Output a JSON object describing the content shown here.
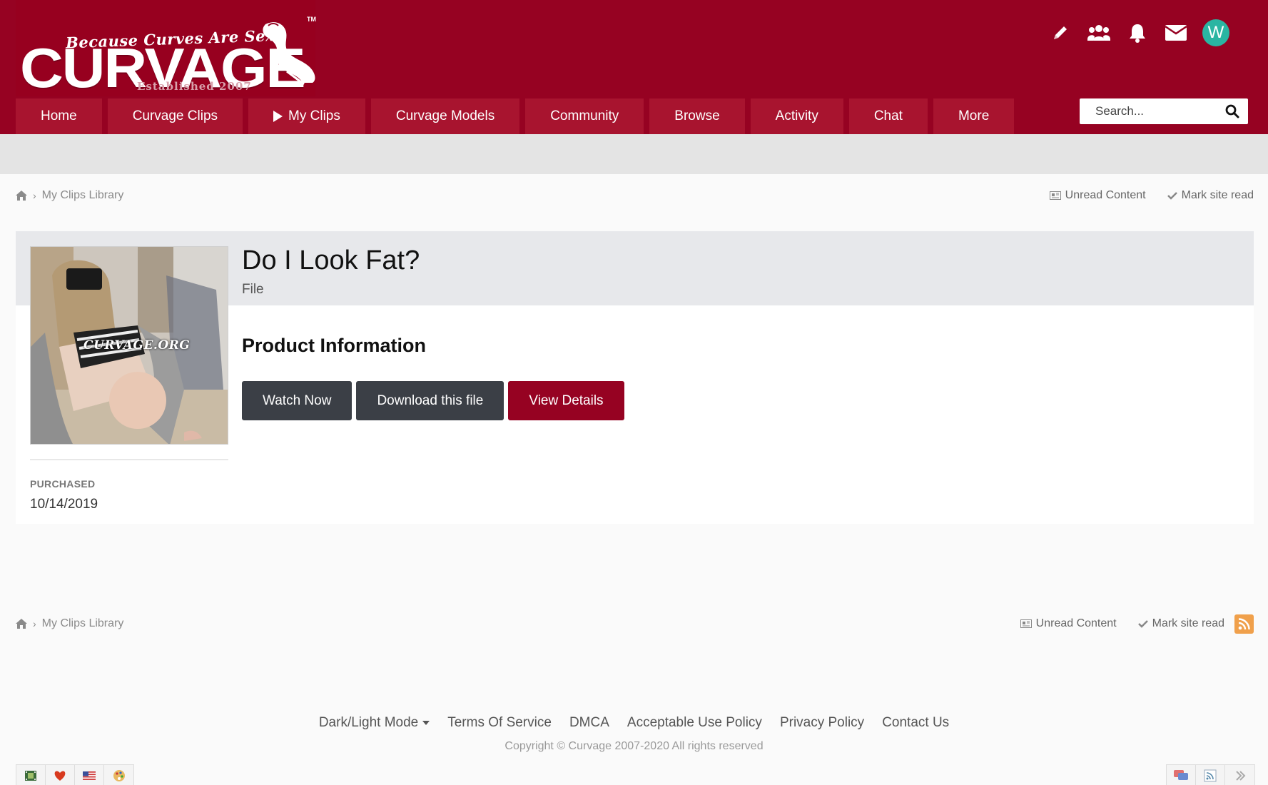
{
  "brand": {
    "tagline": "Because Curves Are Sexy",
    "name": "CURVAGE",
    "established": "Established 2007",
    "trademark": "TM"
  },
  "header": {
    "avatar_letter": "W",
    "icons": [
      "pencil-icon",
      "users-icon",
      "bell-icon",
      "envelope-icon"
    ]
  },
  "nav": {
    "items": [
      "Home",
      "Curvage Clips",
      "My Clips",
      "Curvage Models",
      "Community",
      "Browse",
      "Activity",
      "Chat",
      "More"
    ]
  },
  "search": {
    "placeholder": "Search..."
  },
  "breadcrumb": {
    "current": "My Clips Library",
    "unread": "Unread Content",
    "mark_read": "Mark site read"
  },
  "file": {
    "title": "Do I Look Fat?",
    "type": "File",
    "watermark": "CURVAGE.ORG",
    "section_title": "Product Information",
    "buttons": {
      "watch": "Watch Now",
      "download": "Download this file",
      "details": "View Details"
    },
    "purchased_label": "PURCHASED",
    "purchased_date": "10/14/2019"
  },
  "footer": {
    "links": [
      "Dark/Light Mode",
      "Terms Of Service",
      "DMCA",
      "Acceptable Use Policy",
      "Privacy Policy",
      "Contact Us"
    ],
    "copyright": "Copyright © Curvage 2007-2020 All rights reserved"
  },
  "colors": {
    "brand_red": "#960222",
    "nav_tab": "#a8142f",
    "dark_button": "#3b3f46",
    "avatar": "#2ab5a2",
    "rss": "#f0a04b"
  }
}
